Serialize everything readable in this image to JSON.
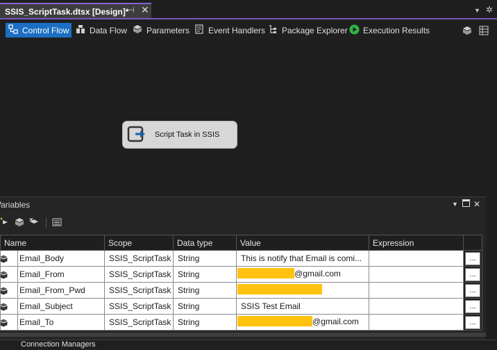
{
  "document_tab": {
    "title": "SSIS_ScriptTask.dtsx [Design]*",
    "pin_glyph": "⊣",
    "close_glyph": "✕"
  },
  "toolbar": {
    "items": [
      {
        "label": "Control Flow",
        "icon": "control-flow-icon",
        "active": true
      },
      {
        "label": "Data Flow",
        "icon": "data-flow-icon",
        "active": false
      },
      {
        "label": "Parameters",
        "icon": "parameters-icon",
        "active": false
      },
      {
        "label": "Event Handlers",
        "icon": "event-handlers-icon",
        "active": false
      },
      {
        "label": "Package Explorer",
        "icon": "package-explorer-icon",
        "active": false
      },
      {
        "label": "Execution Results",
        "icon": "execution-results-icon",
        "active": false
      }
    ]
  },
  "canvas": {
    "task_label": "Script Task in SSIS"
  },
  "variables": {
    "title": "Variables",
    "columns": [
      "Name",
      "Scope",
      "Data type",
      "Value",
      "Expression"
    ],
    "rows": [
      {
        "name": "Email_Body",
        "scope": "SSIS_ScriptTask",
        "data_type": "String",
        "value": "This is notify that Email is comi...",
        "redacted": false,
        "value_suffix": ""
      },
      {
        "name": "Email_From",
        "scope": "SSIS_ScriptTask",
        "data_type": "String",
        "value": "",
        "redacted": true,
        "value_suffix": "@gmail.com"
      },
      {
        "name": "Email_From_Pwd",
        "scope": "SSIS_ScriptTask",
        "data_type": "String",
        "value": "",
        "redacted": true,
        "value_suffix": ""
      },
      {
        "name": "Email_Subject",
        "scope": "SSIS_ScriptTask",
        "data_type": "String",
        "value": "SSIS Test Email",
        "redacted": false,
        "value_suffix": ""
      },
      {
        "name": "Email_To",
        "scope": "SSIS_ScriptTask",
        "data_type": "String",
        "value": "",
        "redacted": true,
        "value_suffix": "@gmail.com"
      }
    ],
    "ellipsis_label": "..."
  },
  "bottom": {
    "tab_label": "Connection Managers"
  },
  "colors": {
    "accent": "#1c6fc2",
    "tab_accent": "#8a63d2",
    "redaction": "#ffc20e",
    "execute_green": "#2fb344"
  }
}
